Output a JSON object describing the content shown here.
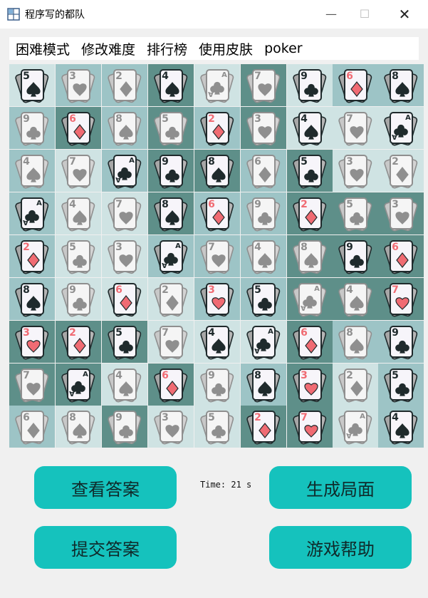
{
  "window": {
    "title": "程序写的都队",
    "minimize_glyph": "—",
    "maximize_glyph": "☐",
    "close_glyph": "✕"
  },
  "menu": [
    "困难模式",
    "修改难度",
    "排行榜",
    "使用皮肤",
    "poker"
  ],
  "board": {
    "rows": [
      [
        {
          "r": "5",
          "s": "spade",
          "on": true,
          "bg": "#cfe3e3"
        },
        {
          "r": "3",
          "s": "heart",
          "on": false,
          "bg": "#9dc4c6"
        },
        {
          "r": "2",
          "s": "diamond",
          "on": false,
          "bg": "#9dc4c6"
        },
        {
          "r": "4",
          "s": "spade",
          "on": true,
          "bg": "#5e8f89"
        },
        {
          "r": "A",
          "s": "club",
          "on": false,
          "bg": "#cfe3e3"
        },
        {
          "r": "7",
          "s": "heart",
          "on": false,
          "bg": "#5e8f89"
        },
        {
          "r": "9",
          "s": "club",
          "on": true,
          "bg": "#cfe3e3"
        },
        {
          "r": "6",
          "s": "diamond",
          "on": true,
          "bg": "#9dc4c6"
        },
        {
          "r": "8",
          "s": "spade",
          "on": true,
          "bg": "#9dc4c6"
        }
      ],
      [
        {
          "r": "9",
          "s": "club",
          "on": false,
          "bg": "#9dc4c6"
        },
        {
          "r": "6",
          "s": "diamond",
          "on": true,
          "bg": "#5e8f89"
        },
        {
          "r": "8",
          "s": "spade",
          "on": false,
          "bg": "#9dc4c6"
        },
        {
          "r": "5",
          "s": "club",
          "on": false,
          "bg": "#5e8f89"
        },
        {
          "r": "2",
          "s": "diamond",
          "on": true,
          "bg": "#9dc4c6"
        },
        {
          "r": "3",
          "s": "heart",
          "on": false,
          "bg": "#5e8f89"
        },
        {
          "r": "4",
          "s": "spade",
          "on": true,
          "bg": "#cfe3e3"
        },
        {
          "r": "7",
          "s": "heart",
          "on": false,
          "bg": "#cfe3e3"
        },
        {
          "r": "A",
          "s": "club",
          "on": true,
          "bg": "#cfe3e3"
        }
      ],
      [
        {
          "r": "4",
          "s": "spade",
          "on": false,
          "bg": "#9dc4c6"
        },
        {
          "r": "7",
          "s": "heart",
          "on": false,
          "bg": "#cfe3e3"
        },
        {
          "r": "A",
          "s": "club",
          "on": true,
          "bg": "#9dc4c6"
        },
        {
          "r": "9",
          "s": "club",
          "on": true,
          "bg": "#5e8f89"
        },
        {
          "r": "8",
          "s": "spade",
          "on": true,
          "bg": "#5e8f89"
        },
        {
          "r": "6",
          "s": "diamond",
          "on": false,
          "bg": "#9dc4c6"
        },
        {
          "r": "5",
          "s": "club",
          "on": true,
          "bg": "#5e8f89"
        },
        {
          "r": "3",
          "s": "heart",
          "on": false,
          "bg": "#cfe3e3"
        },
        {
          "r": "2",
          "s": "diamond",
          "on": false,
          "bg": "#cfe3e3"
        }
      ],
      [
        {
          "r": "A",
          "s": "club",
          "on": true,
          "bg": "#9dc4c6"
        },
        {
          "r": "4",
          "s": "spade",
          "on": false,
          "bg": "#cfe3e3"
        },
        {
          "r": "7",
          "s": "heart",
          "on": false,
          "bg": "#cfe3e3"
        },
        {
          "r": "8",
          "s": "spade",
          "on": true,
          "bg": "#5e8f89"
        },
        {
          "r": "6",
          "s": "diamond",
          "on": true,
          "bg": "#9dc4c6"
        },
        {
          "r": "9",
          "s": "club",
          "on": false,
          "bg": "#9dc4c6"
        },
        {
          "r": "2",
          "s": "diamond",
          "on": true,
          "bg": "#5e8f89"
        },
        {
          "r": "5",
          "s": "club",
          "on": false,
          "bg": "#5e8f89"
        },
        {
          "r": "3",
          "s": "heart",
          "on": false,
          "bg": "#5e8f89"
        }
      ],
      [
        {
          "r": "2",
          "s": "diamond",
          "on": true,
          "bg": "#9dc4c6"
        },
        {
          "r": "5",
          "s": "club",
          "on": false,
          "bg": "#cfe3e3"
        },
        {
          "r": "3",
          "s": "heart",
          "on": false,
          "bg": "#cfe3e3"
        },
        {
          "r": "A",
          "s": "club",
          "on": true,
          "bg": "#9dc4c6"
        },
        {
          "r": "7",
          "s": "heart",
          "on": false,
          "bg": "#9dc4c6"
        },
        {
          "r": "4",
          "s": "spade",
          "on": false,
          "bg": "#9dc4c6"
        },
        {
          "r": "8",
          "s": "spade",
          "on": false,
          "bg": "#5e8f89"
        },
        {
          "r": "9",
          "s": "club",
          "on": true,
          "bg": "#5e8f89"
        },
        {
          "r": "6",
          "s": "diamond",
          "on": true,
          "bg": "#5e8f89"
        }
      ],
      [
        {
          "r": "8",
          "s": "spade",
          "on": true,
          "bg": "#9dc4c6"
        },
        {
          "r": "9",
          "s": "club",
          "on": false,
          "bg": "#cfe3e3"
        },
        {
          "r": "6",
          "s": "diamond",
          "on": true,
          "bg": "#cfe3e3"
        },
        {
          "r": "2",
          "s": "diamond",
          "on": false,
          "bg": "#cfe3e3"
        },
        {
          "r": "3",
          "s": "heart",
          "on": true,
          "bg": "#9dc4c6"
        },
        {
          "r": "5",
          "s": "club",
          "on": true,
          "bg": "#9dc4c6"
        },
        {
          "r": "A",
          "s": "club",
          "on": false,
          "bg": "#5e8f89"
        },
        {
          "r": "4",
          "s": "spade",
          "on": false,
          "bg": "#5e8f89"
        },
        {
          "r": "7",
          "s": "heart",
          "on": true,
          "bg": "#5e8f89"
        }
      ],
      [
        {
          "r": "3",
          "s": "heart",
          "on": true,
          "bg": "#5e8f89"
        },
        {
          "r": "2",
          "s": "diamond",
          "on": true,
          "bg": "#5e8f89"
        },
        {
          "r": "5",
          "s": "club",
          "on": true,
          "bg": "#5e8f89"
        },
        {
          "r": "7",
          "s": "heart",
          "on": false,
          "bg": "#cfe3e3"
        },
        {
          "r": "4",
          "s": "spade",
          "on": true,
          "bg": "#cfe3e3"
        },
        {
          "r": "A",
          "s": "club",
          "on": true,
          "bg": "#cfe3e3"
        },
        {
          "r": "6",
          "s": "diamond",
          "on": true,
          "bg": "#5e8f89"
        },
        {
          "r": "8",
          "s": "spade",
          "on": false,
          "bg": "#9dc4c6"
        },
        {
          "r": "9",
          "s": "club",
          "on": true,
          "bg": "#9dc4c6"
        }
      ],
      [
        {
          "r": "7",
          "s": "heart",
          "on": false,
          "bg": "#5e8f89"
        },
        {
          "r": "A",
          "s": "club",
          "on": true,
          "bg": "#5e8f89"
        },
        {
          "r": "4",
          "s": "spade",
          "on": false,
          "bg": "#cfe3e3"
        },
        {
          "r": "6",
          "s": "diamond",
          "on": true,
          "bg": "#5e8f89"
        },
        {
          "r": "9",
          "s": "club",
          "on": false,
          "bg": "#cfe3e3"
        },
        {
          "r": "8",
          "s": "spade",
          "on": true,
          "bg": "#9dc4c6"
        },
        {
          "r": "3",
          "s": "heart",
          "on": true,
          "bg": "#5e8f89"
        },
        {
          "r": "2",
          "s": "diamond",
          "on": false,
          "bg": "#cfe3e3"
        },
        {
          "r": "5",
          "s": "club",
          "on": true,
          "bg": "#9dc4c6"
        }
      ],
      [
        {
          "r": "6",
          "s": "diamond",
          "on": false,
          "bg": "#9dc4c6"
        },
        {
          "r": "8",
          "s": "spade",
          "on": false,
          "bg": "#cfe3e3"
        },
        {
          "r": "9",
          "s": "club",
          "on": false,
          "bg": "#5e8f89"
        },
        {
          "r": "3",
          "s": "heart",
          "on": false,
          "bg": "#cfe3e3"
        },
        {
          "r": "5",
          "s": "club",
          "on": false,
          "bg": "#cfe3e3"
        },
        {
          "r": "2",
          "s": "diamond",
          "on": true,
          "bg": "#5e8f89"
        },
        {
          "r": "7",
          "s": "heart",
          "on": true,
          "bg": "#5e8f89"
        },
        {
          "r": "A",
          "s": "club",
          "on": false,
          "bg": "#cfe3e3"
        },
        {
          "r": "4",
          "s": "spade",
          "on": true,
          "bg": "#9dc4c6"
        }
      ]
    ]
  },
  "buttons": {
    "view_answer": "查看答案",
    "generate": "生成局面",
    "submit": "提交答案",
    "help": "游戏帮助"
  },
  "timer": "Time: 21 s",
  "colors": {
    "button": "#15c2bd",
    "red_suit": "#f06b73",
    "black_suit": "#1f2a2c",
    "grey_suit": "#8f8f8f"
  }
}
